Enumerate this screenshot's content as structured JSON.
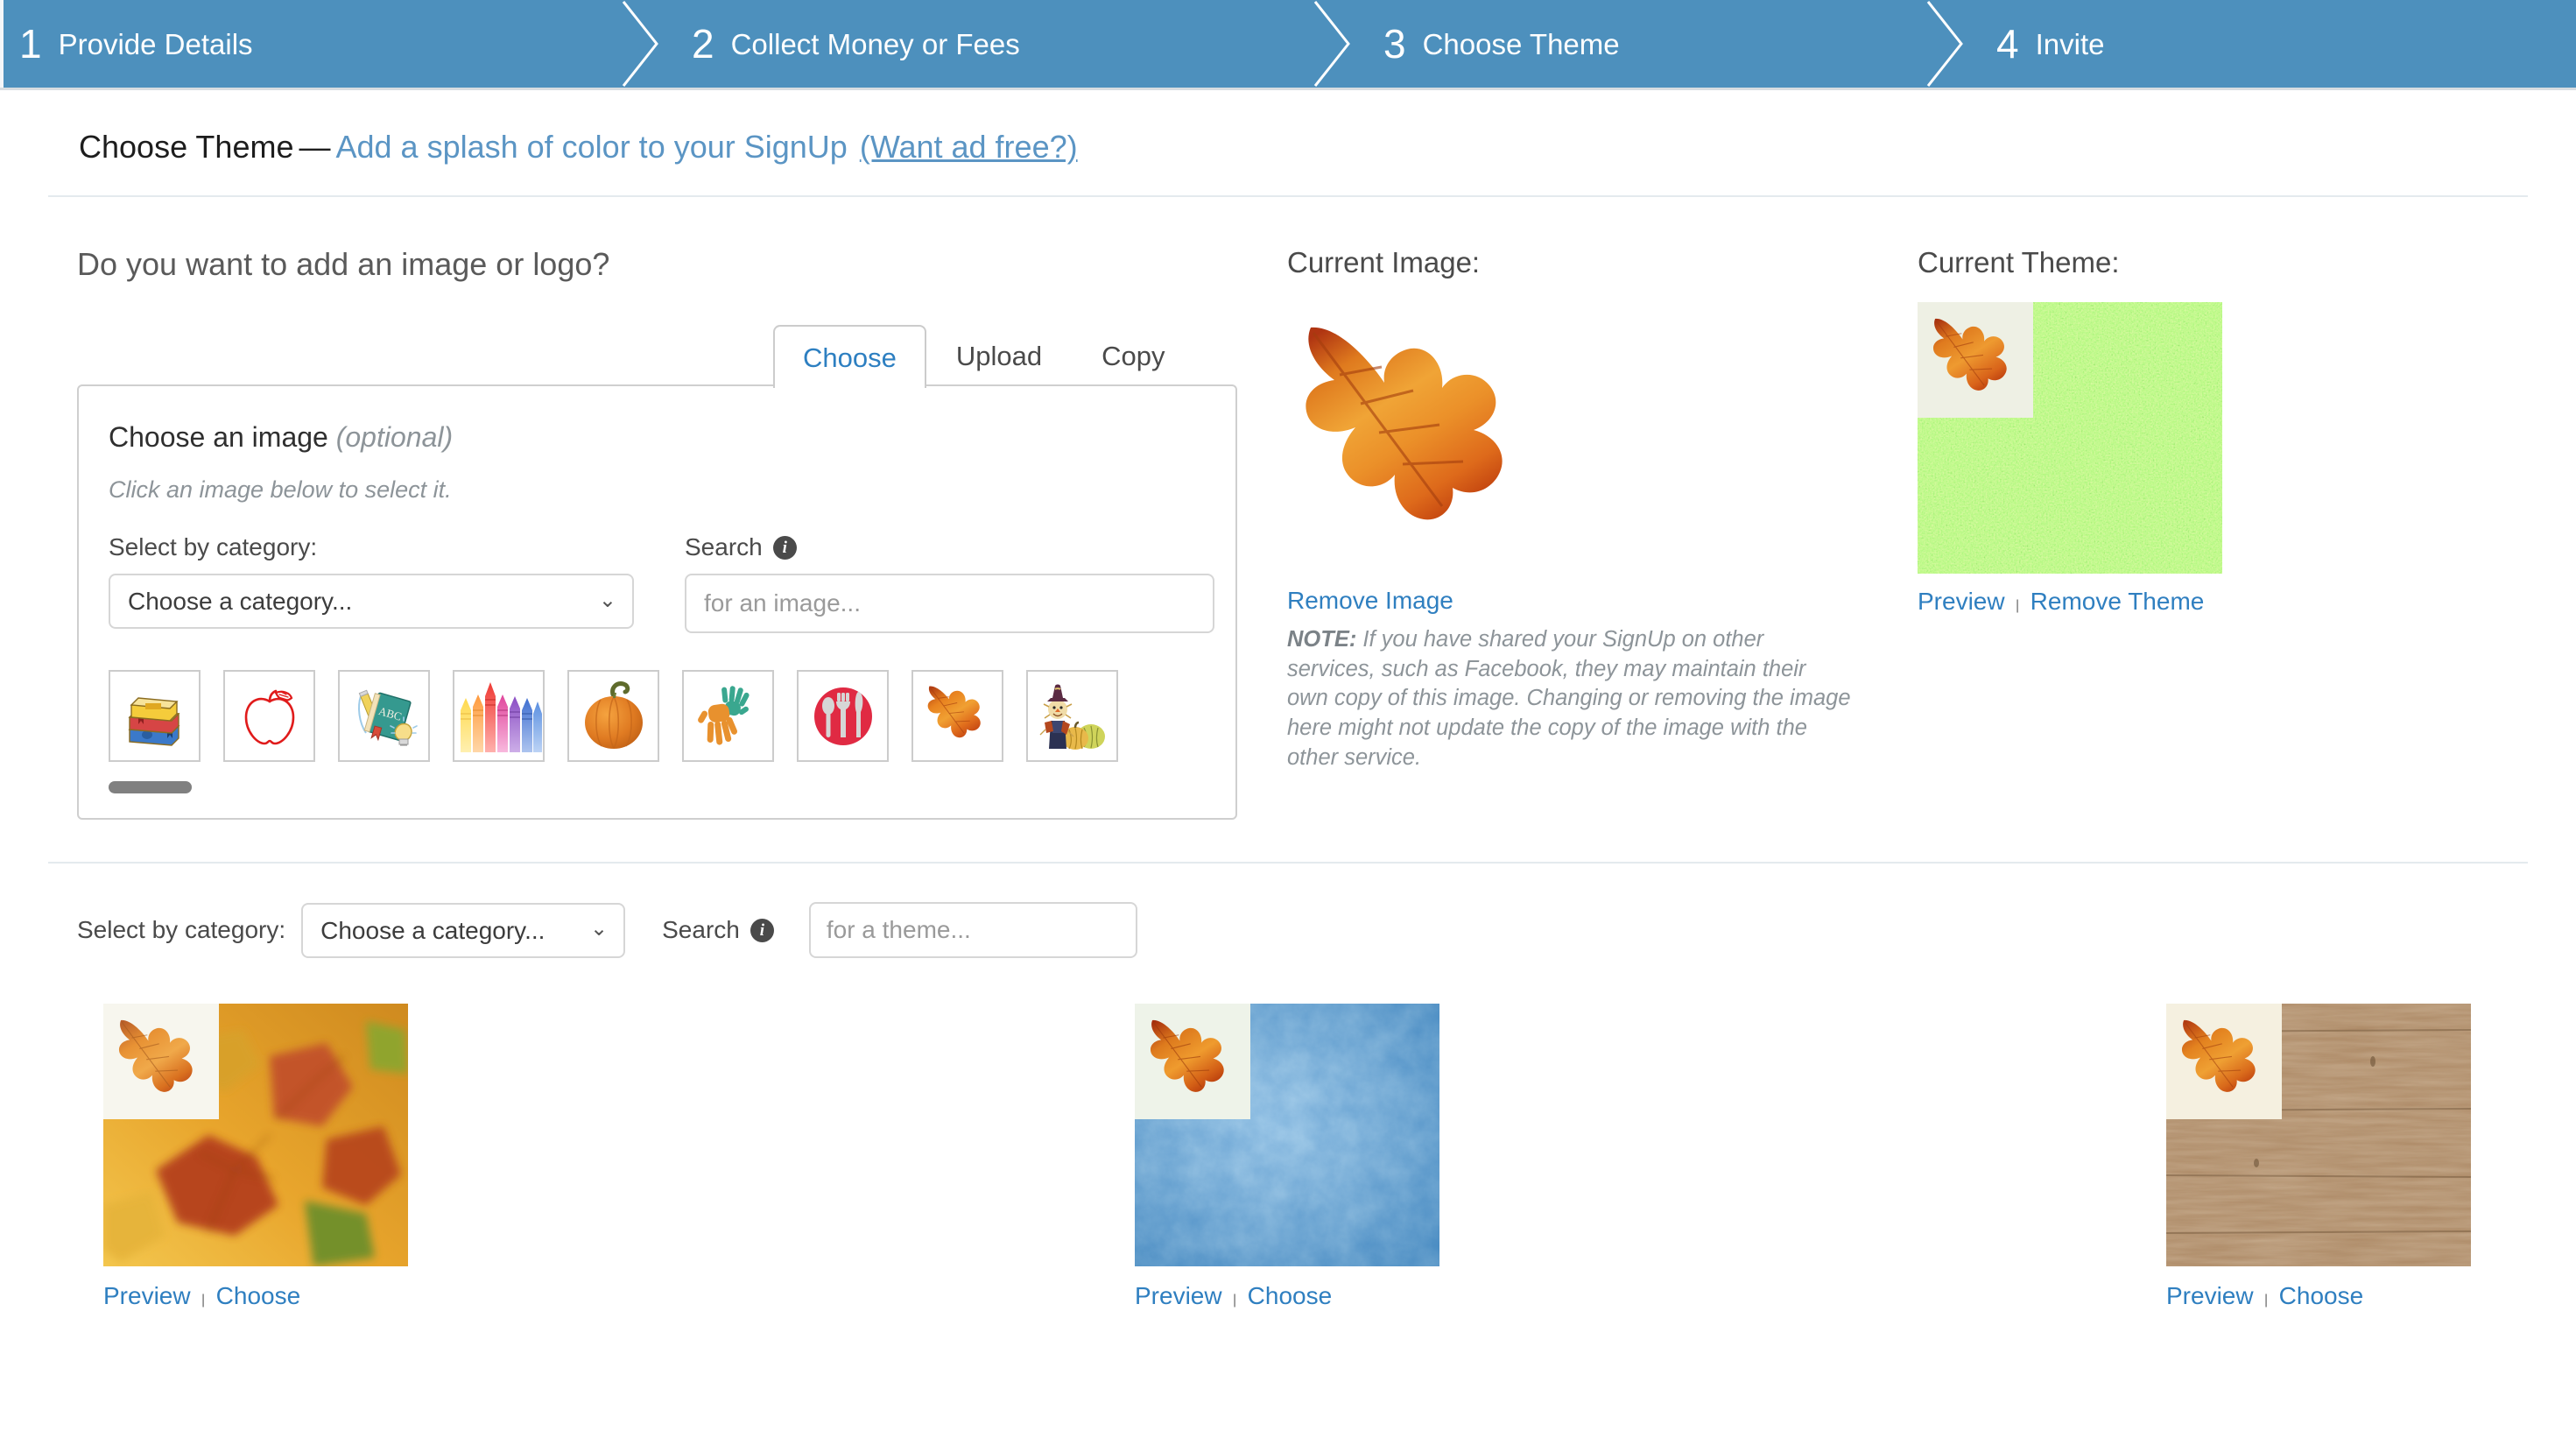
{
  "wizard": {
    "steps": [
      {
        "num": "1",
        "label": "Provide Details"
      },
      {
        "num": "2",
        "label": "Collect Money or Fees"
      },
      {
        "num": "3",
        "label": "Choose Theme"
      },
      {
        "num": "4",
        "label": "Invite"
      }
    ],
    "bar_color": "#4d90bd"
  },
  "page_title": {
    "strong": "Choose Theme",
    "dash": "—",
    "link": "Add a splash of color to your SignUp",
    "ad_free_link": "(Want ad free?)",
    "link_color": "#5b95c4"
  },
  "image_section": {
    "question": "Do you want to add an image or logo?",
    "tabs": [
      {
        "label": "Choose",
        "active": true
      },
      {
        "label": "Upload",
        "active": false
      },
      {
        "label": "Copy",
        "active": false
      }
    ],
    "panel_title": "Choose an image",
    "panel_title_optional": "(optional)",
    "panel_subtitle": "Click an image below to select it.",
    "category_label": "Select by category:",
    "category_value": "Choose a category...",
    "search_label": "Search",
    "search_info_icon": "info-icon",
    "search_placeholder": "for an image...",
    "search_value": "",
    "thumbnails": [
      {
        "name": "stack-of-books-icon",
        "alt": "Stack of books"
      },
      {
        "name": "apple-outline-icon",
        "alt": "Red apple outline"
      },
      {
        "name": "abc-book-pencil-lightbulb-icon",
        "alt": "ABC book with pencil and lightbulb"
      },
      {
        "name": "crayons-icon",
        "alt": "Row of colored crayons"
      },
      {
        "name": "pumpkin-icon",
        "alt": "Orange pumpkin"
      },
      {
        "name": "handprints-icon",
        "alt": "Orange and green handprints"
      },
      {
        "name": "plate-utensils-icon",
        "alt": "Red plate with spoon fork knife"
      },
      {
        "name": "oak-leaf-icon",
        "alt": "Orange oak leaf"
      },
      {
        "name": "scarecrow-gourds-icon",
        "alt": "Scarecrow with gourds"
      }
    ]
  },
  "current_image": {
    "title": "Current Image:",
    "image_name": "oak-leaf-image",
    "remove_label": "Remove Image",
    "note_prefix": "NOTE:",
    "note_body": " If you have shared your SignUp on other services, such as Facebook, they may maintain their own copy of this image. Changing or removing the image here might not update the copy of the image with the other service."
  },
  "current_theme": {
    "title": "Current Theme:",
    "theme_name": "grass-theme",
    "preview_label": "Preview",
    "separator": "|",
    "remove_label": "Remove Theme"
  },
  "theme_filter": {
    "category_label": "Select by category:",
    "category_value": "Choose a category...",
    "search_label": "Search",
    "search_info_icon": "info-icon",
    "search_placeholder": "for a theme...",
    "search_value": ""
  },
  "theme_gallery": {
    "items": [
      {
        "name": "autumn-leaves-theme",
        "preview_label": "Preview",
        "separator": "|",
        "choose_label": "Choose",
        "swatch": "#e8a42a"
      },
      {
        "name": "blue-texture-theme",
        "preview_label": "Preview",
        "separator": "|",
        "choose_label": "Choose",
        "swatch": "#4a90cc"
      },
      {
        "name": "wood-planks-theme",
        "preview_label": "Preview",
        "separator": "|",
        "choose_label": "Choose",
        "swatch": "#ab8763"
      }
    ]
  }
}
